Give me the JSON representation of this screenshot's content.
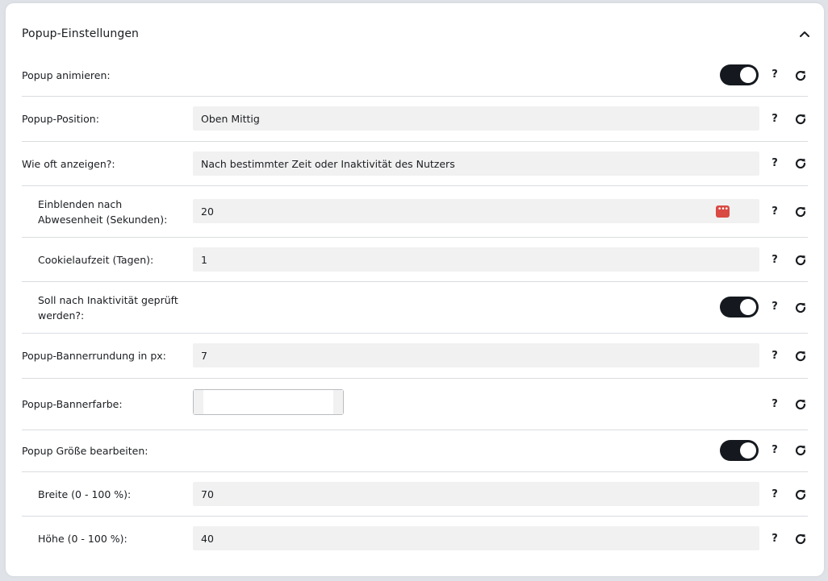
{
  "panel": {
    "title": "Popup-Einstellungen"
  },
  "icons": {
    "collapse": "chevron-up-icon",
    "help": "help-question-icon",
    "reset": "reset-icon",
    "password_manager": "password-dots-icon"
  },
  "help_symbol": "?",
  "password_dots": "•••",
  "colors": {
    "toggle_on": "#15191f",
    "field_bg": "#f1f1f1",
    "password_icon": "#d94a43"
  },
  "rows": {
    "animate": {
      "label": "Popup animieren:",
      "toggle": true
    },
    "position": {
      "label": "Popup-Position:",
      "value": "Oben Mittig"
    },
    "frequency": {
      "label": "Wie oft anzeigen?:",
      "value": "Nach bestimmter Zeit oder Inaktivität des Nutzers"
    },
    "delay": {
      "label_line1": "Einblenden nach",
      "label_line2": "Abwesenheit (Sekunden):",
      "value": "20"
    },
    "cookie": {
      "label": "Cookielaufzeit (Tagen):",
      "value": "1"
    },
    "inactivity": {
      "label_line1": "Soll nach Inaktivität geprüft",
      "label_line2": "werden?:",
      "toggle": true
    },
    "rounding": {
      "label": "Popup-Bannerrundung in px:",
      "value": "7"
    },
    "banner_color": {
      "label": "Popup-Bannerfarbe:",
      "value": ""
    },
    "size_edit": {
      "label": "Popup Größe bearbeiten:",
      "toggle": true
    },
    "width": {
      "label": "Breite (0 - 100 %):",
      "value": "70"
    },
    "height": {
      "label": "Höhe (0 - 100 %):",
      "value": "40"
    }
  }
}
